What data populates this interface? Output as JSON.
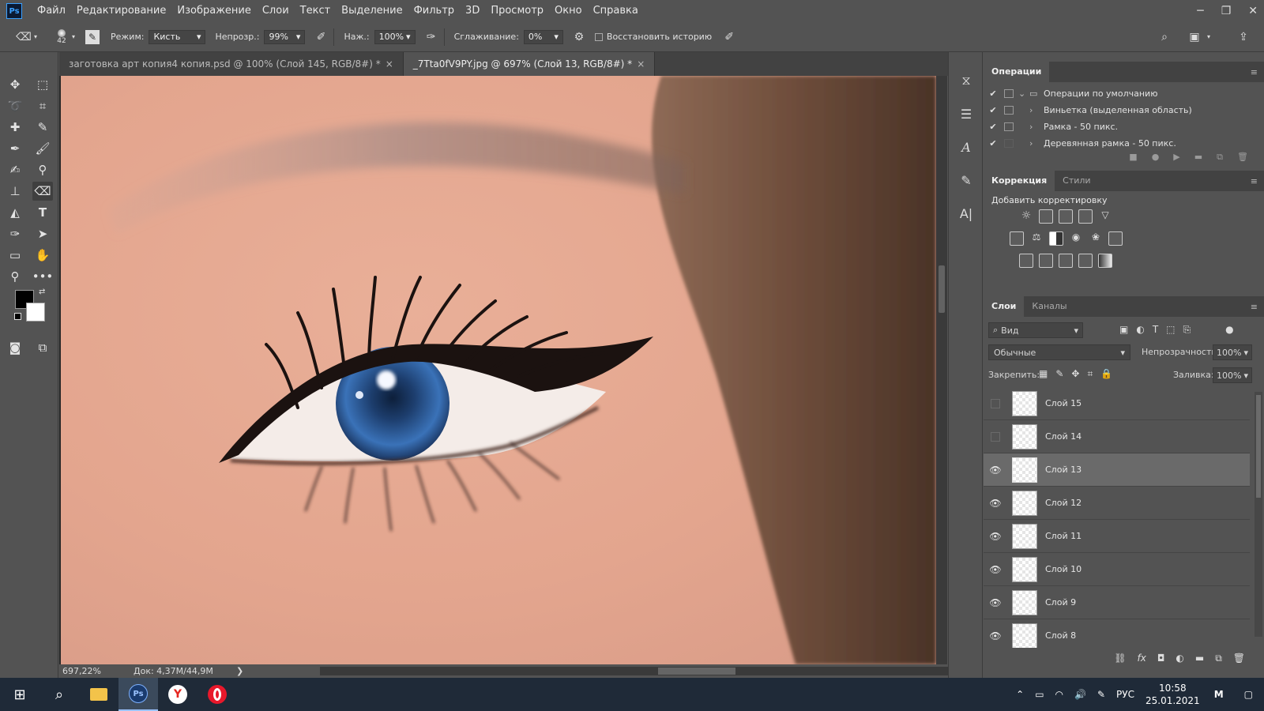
{
  "app": {
    "logo": "Ps"
  },
  "menu": [
    "Файл",
    "Редактирование",
    "Изображение",
    "Слои",
    "Текст",
    "Выделение",
    "Фильтр",
    "3D",
    "Просмотр",
    "Окно",
    "Справка"
  ],
  "options": {
    "brush_size": "42",
    "mode_label": "Режим:",
    "mode_value": "Кисть",
    "opacity_label": "Непрозр.:",
    "opacity_value": "99%",
    "pressure_label": "Наж.:",
    "pressure_value": "100%",
    "smoothing_label": "Сглаживание:",
    "smoothing_value": "0%",
    "restore_history": "Восстановить историю"
  },
  "tabs": [
    {
      "label": "заготовка арт копия4 копия.psd @ 100% (Слой 145, RGB/8#) *",
      "close": "×"
    },
    {
      "label": "_7Tta0fV9PY.jpg @ 697% (Слой 13, RGB/8#) *",
      "close": "×"
    }
  ],
  "status": {
    "zoom": "697,22%",
    "doc": "Док: 4,37M/44,9M",
    "arrow": "❯"
  },
  "actions_panel": {
    "tab": "Операции",
    "rows": [
      {
        "label": "Операции по умолчанию",
        "check": "✔"
      },
      {
        "label": "Виньетка (выделенная область)",
        "check": "✔"
      },
      {
        "label": "Рамка - 50 пикс.",
        "check": "✔"
      },
      {
        "label": "Деревянная рамка - 50 пикс.",
        "check": "✔"
      }
    ]
  },
  "adjust_panel": {
    "tabs": [
      "Коррекция",
      "Стили"
    ],
    "heading": "Добавить корректировку"
  },
  "layers_panel": {
    "tabs": [
      "Слои",
      "Каналы"
    ],
    "filter_label": "Вид",
    "blend_mode": "Обычные",
    "opacity_label": "Непрозрачность:",
    "opacity_value": "100%",
    "lock_label": "Закрепить:",
    "fill_label": "Заливка:",
    "fill_value": "100%",
    "layers": [
      {
        "name": "Слой 15",
        "visible": false,
        "selected": false
      },
      {
        "name": "Слой 14",
        "visible": false,
        "selected": false
      },
      {
        "name": "Слой 13",
        "visible": true,
        "selected": true
      },
      {
        "name": "Слой 12",
        "visible": true,
        "selected": false
      },
      {
        "name": "Слой 11",
        "visible": true,
        "selected": false
      },
      {
        "name": "Слой 10",
        "visible": true,
        "selected": false
      },
      {
        "name": "Слой 9",
        "visible": true,
        "selected": false
      },
      {
        "name": "Слой 8",
        "visible": true,
        "selected": false
      }
    ]
  },
  "taskbar": {
    "lang": "РУС",
    "time": "10:58",
    "date": "25.01.2021"
  },
  "colors": {
    "skin": "#e4a58f",
    "iris": "#2f5f9e",
    "hair": "#6b4a38",
    "ui_bg": "#535353",
    "taskbar": "#1f2a38"
  }
}
